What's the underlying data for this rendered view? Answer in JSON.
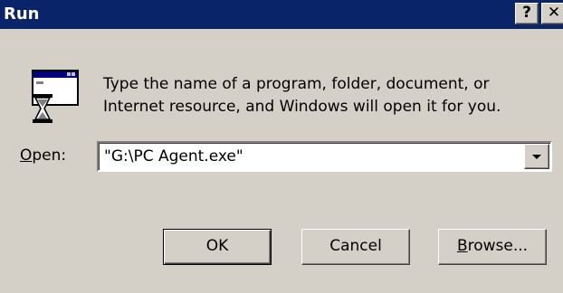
{
  "window": {
    "title": "Run",
    "help_glyph": "?",
    "close_glyph": "✕"
  },
  "dialog": {
    "description_line1": "Type the name of a program, folder, document, or",
    "description_line2": "Internet resource, and Windows will open it for you.",
    "open_label_mnemonic": "O",
    "open_label_rest": "pen:",
    "open_value": "\"G:\\PC Agent.exe\"",
    "icon": "run-program-icon"
  },
  "buttons": {
    "ok_label": "OK",
    "cancel_label": "Cancel",
    "browse_mnemonic": "B",
    "browse_rest": "rowse..."
  },
  "colors": {
    "titlebar": "#0a246a",
    "face": "#d4d0c8"
  }
}
